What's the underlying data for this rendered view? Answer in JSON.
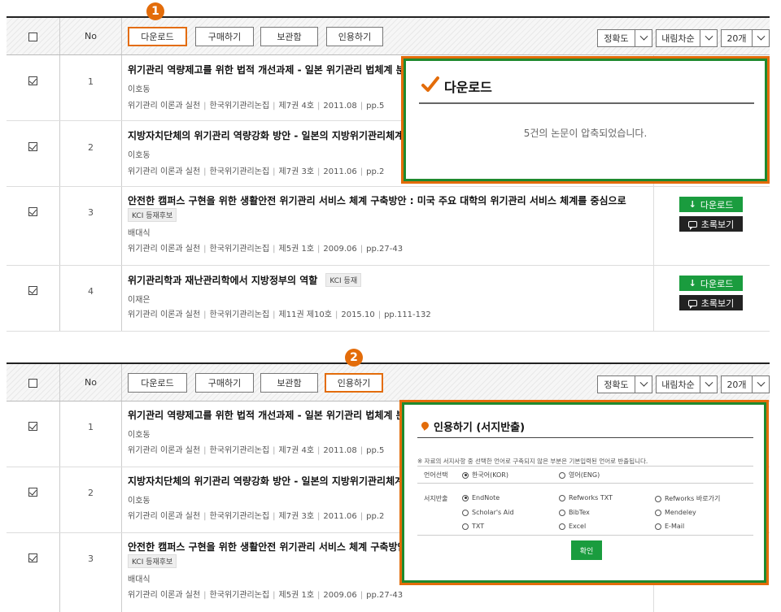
{
  "toolbar": {
    "no_label": "No",
    "download": "다운로드",
    "purchase": "구매하기",
    "archive": "보관함",
    "cite": "인용하기",
    "sort_accuracy": "정확도",
    "sort_order": "내림차순",
    "page_size": "20개"
  },
  "badges": {
    "one": "1",
    "two": "2"
  },
  "rows": [
    {
      "no": "1",
      "title": "위기관리 역량제고를 위한 법적 개선과제 - 일본 위기관리 법체계 분석",
      "author": "이호동",
      "journal": "위기관리 이론과 실천",
      "society": "한국위기관리논집",
      "vol": "제7권 4호",
      "date": "2011.08",
      "pages": "pp.5"
    },
    {
      "no": "2",
      "title": "지방자치단체의 위기관리 역량강화 방안 - 일본의 지방위기관리체계",
      "author": "이호동",
      "journal": "위기관리 이론과 실천",
      "society": "한국위기관리논집",
      "vol": "제7권 3호",
      "date": "2011.06",
      "pages": "pp.2"
    },
    {
      "no": "3",
      "title": "안전한 캠퍼스 구현을 위한 생활안전 위기관리 서비스 체계 구축방안 : 미국 주요 대학의 위기관리 서비스 체계를 중심으로",
      "kci": "KCI 등재후보",
      "author": "배대식",
      "journal": "위기관리 이론과 실천",
      "society": "한국위기관리논집",
      "vol": "제5권 1호",
      "date": "2009.06",
      "pages": "pp.27-43"
    },
    {
      "no": "4",
      "title": "위기관리학과 재난관리학에서 지방정부의 역할",
      "kci": "KCI 등재",
      "author": "이재은",
      "journal": "위기관리 이론과 실천",
      "society": "한국위기관리논집",
      "vol": "제11권 제10호",
      "date": "2015.10",
      "pages": "pp.111-132"
    }
  ],
  "rows2": [
    {
      "no": "1",
      "title": "위기관리 역량제고를 위한 법적 개선과제 - 일본 위기관리 법체계 분석",
      "author": "이호동",
      "journal": "위기관리 이론과 실천",
      "society": "한국위기관리논집",
      "vol": "제7권 4호",
      "date": "2011.08",
      "pages": "pp.5"
    },
    {
      "no": "2",
      "title": "지방자치단체의 위기관리 역량강화 방안 - 일본의 지방위기관리체계",
      "author": "이호동",
      "journal": "위기관리 이론과 실천",
      "society": "한국위기관리논집",
      "vol": "제7권 3호",
      "date": "2011.06",
      "pages": "pp.2"
    },
    {
      "no": "3",
      "title": "안전한 캠퍼스 구현을 위한 생활안전 위기관리 서비스 체계 구축방안",
      "kci": "KCI 등재후보",
      "author": "배대식",
      "journal": "위기관리 이론과 실천",
      "society": "한국위기관리논집",
      "vol": "제5권 1호",
      "date": "2009.06",
      "pages": "pp.27-43"
    }
  ],
  "actions": {
    "download": "다운로드",
    "abstract": "초록보기"
  },
  "download_popup": {
    "title": "다운로드",
    "message": "5건의 논문이 압축되었습니다."
  },
  "cite_popup": {
    "title": "인용하기 (서지반출)",
    "note": "※ 자료의 서지사항 중 선택한 언어로 구축되지 않은 부분은 기본입력된 언어로 반출됩니다.",
    "lang_label": "언어선택",
    "lang_options": [
      "한국어(KOR)",
      "영어(ENG)"
    ],
    "export_label": "서지반출",
    "export_options": [
      "EndNote",
      "Refworks TXT",
      "Refworks 바로가기",
      "Scholar's Aid",
      "BibTex",
      "Mendeley",
      "TXT",
      "Excel",
      "E-Mail"
    ],
    "confirm": "확인"
  },
  "colors": {
    "accent_orange": "#e36c0a",
    "popup_green": "#1e8a2e",
    "button_green": "#1a9c3e"
  }
}
